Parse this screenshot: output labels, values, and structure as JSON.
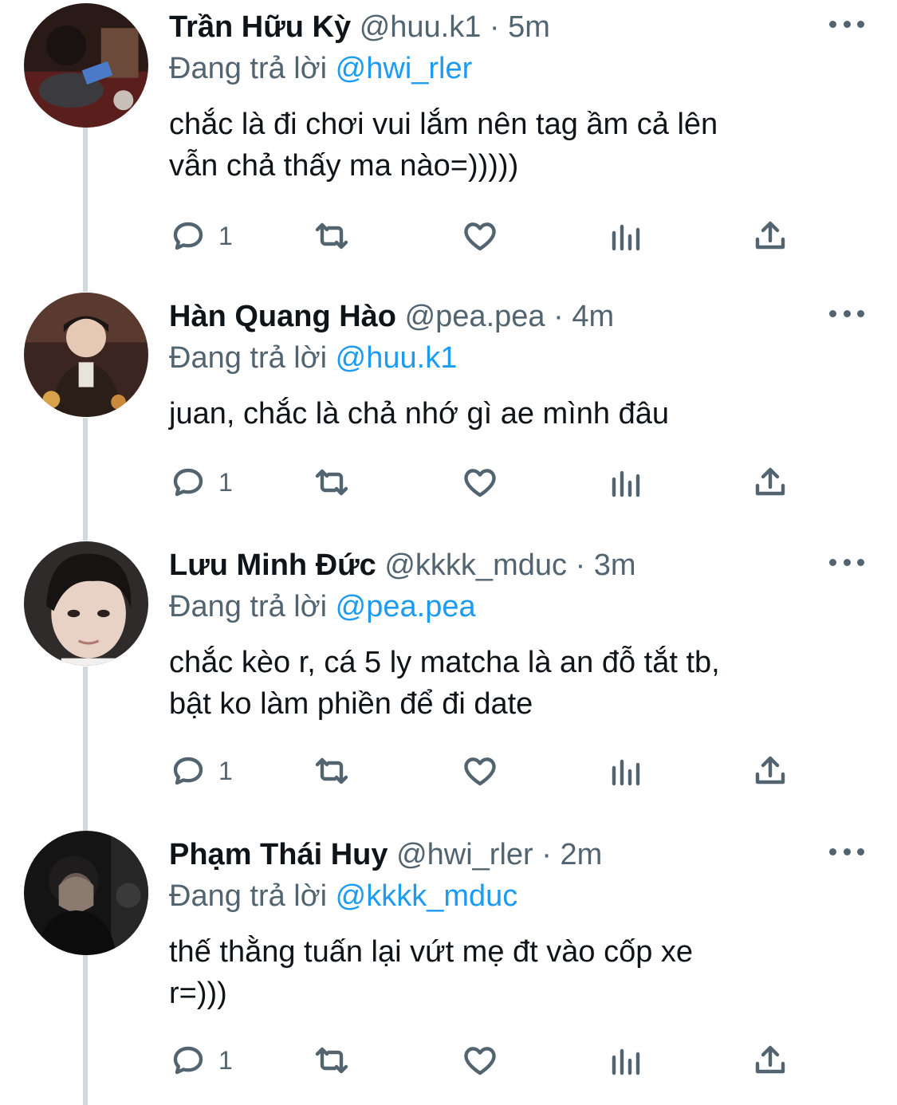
{
  "replying_label": "Đang trả lời",
  "tweets": [
    {
      "name": "Trần Hữu Kỳ",
      "handle": "@huu.k1",
      "time": "5m",
      "reply_to": "@hwi_rler",
      "text": "chắc là đi chơi vui lắm nên tag ầm cả lên\nvẫn chả thấy ma nào=)))))",
      "reply_count": "1"
    },
    {
      "name": "Hàn Quang Hào",
      "handle": "@pea.pea",
      "time": "4m",
      "reply_to": "@huu.k1",
      "text": "juan, chắc là chả nhớ gì ae mình đâu",
      "reply_count": "1"
    },
    {
      "name": "Lưu Minh Đức",
      "handle": "@kkkk_mduc",
      "time": "3m",
      "reply_to": "@pea.pea",
      "text": "chắc kèo r, cá 5 ly matcha là an đỗ tắt tb,\nbật ko làm phiền để đi date",
      "reply_count": "1"
    },
    {
      "name": "Phạm Thái Huy",
      "handle": "@hwi_rler",
      "time": "2m",
      "reply_to": "@kkkk_mduc",
      "text": "thế thằng tuấn lại vứt mẹ đt vào cốp xe\nr=)))",
      "reply_count": "1"
    }
  ],
  "separator": "·",
  "icons": {
    "reply": "reply-icon",
    "retweet": "retweet-icon",
    "like": "heart-icon",
    "views": "views-chart-icon",
    "share": "share-icon",
    "more": "more-icon"
  },
  "colors": {
    "link": "#1d9bf0",
    "secondary_text": "#536471",
    "primary_text": "#0f1419",
    "thread_line": "#cfd9de"
  }
}
